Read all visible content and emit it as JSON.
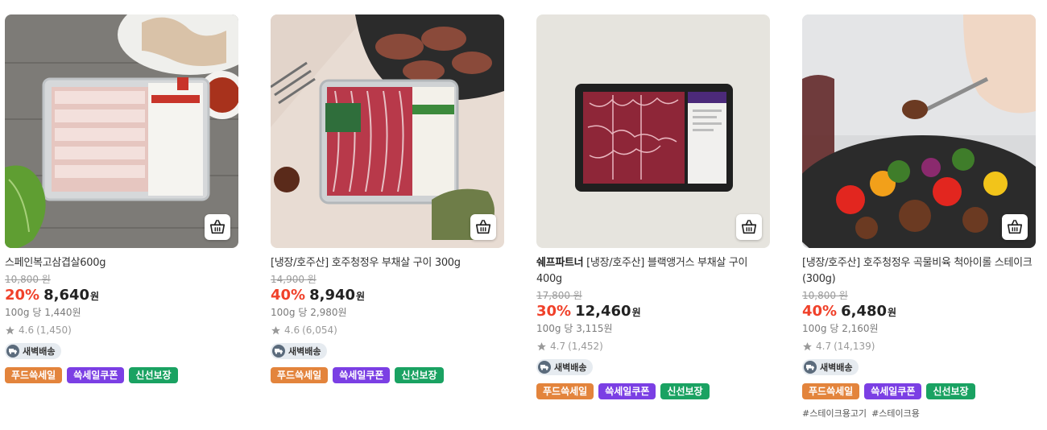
{
  "colors": {
    "discount": "#f0412a",
    "badge_food": "#e3843c",
    "badge_coupon": "#7b3fe4",
    "badge_fresh": "#1aa262"
  },
  "products": [
    {
      "brand": "",
      "name": "스페인복고삼겹살600g",
      "original_price": "10,800 원",
      "discount": "20%",
      "price": "8,640",
      "currency": "원",
      "unit_price": "100g 당 1,440원",
      "rating": "4.6",
      "review_count": "(1,450)",
      "delivery": "새벽배송",
      "badges": [
        "푸드쓱세일",
        "쓱세일쿠폰",
        "신선보장"
      ],
      "tags": [],
      "image_icon": "pork-belly-photo"
    },
    {
      "brand": "",
      "name": "[냉장/호주산] 호주청정우 부채살 구이 300g",
      "original_price": "14,900 원",
      "discount": "40%",
      "price": "8,940",
      "currency": "원",
      "unit_price": "100g 당 2,980원",
      "rating": "4.6",
      "review_count": "(6,054)",
      "delivery": "새벽배송",
      "badges": [
        "푸드쓱세일",
        "쓱세일쿠폰",
        "신선보장"
      ],
      "tags": [],
      "image_icon": "beef-tray-photo"
    },
    {
      "brand": "쉐프파트너",
      "name": "[냉장/호주산] 블랙앵거스 부채살 구이 400g",
      "original_price": "17,800 원",
      "discount": "30%",
      "price": "12,460",
      "currency": "원",
      "unit_price": "100g 당 3,115원",
      "rating": "4.7",
      "review_count": "(1,452)",
      "delivery": "새벽배송",
      "badges": [
        "푸드쓱세일",
        "쓱세일쿠폰",
        "신선보장"
      ],
      "tags": [],
      "image_icon": "angus-tray-photo"
    },
    {
      "brand": "",
      "name": "[냉장/호주산] 호주청정우 곡물비육 척아이롤 스테이크 (300g)",
      "original_price": "10,800 원",
      "discount": "40%",
      "price": "6,480",
      "currency": "원",
      "unit_price": "100g 당 2,160원",
      "rating": "4.7",
      "review_count": "(14,139)",
      "delivery": "새벽배송",
      "badges": [
        "푸드쓱세일",
        "쓱세일쿠폰",
        "신선보장"
      ],
      "tags": [
        "#스테이크용고기",
        "#스테이크용"
      ],
      "image_icon": "steak-dish-photo"
    }
  ]
}
